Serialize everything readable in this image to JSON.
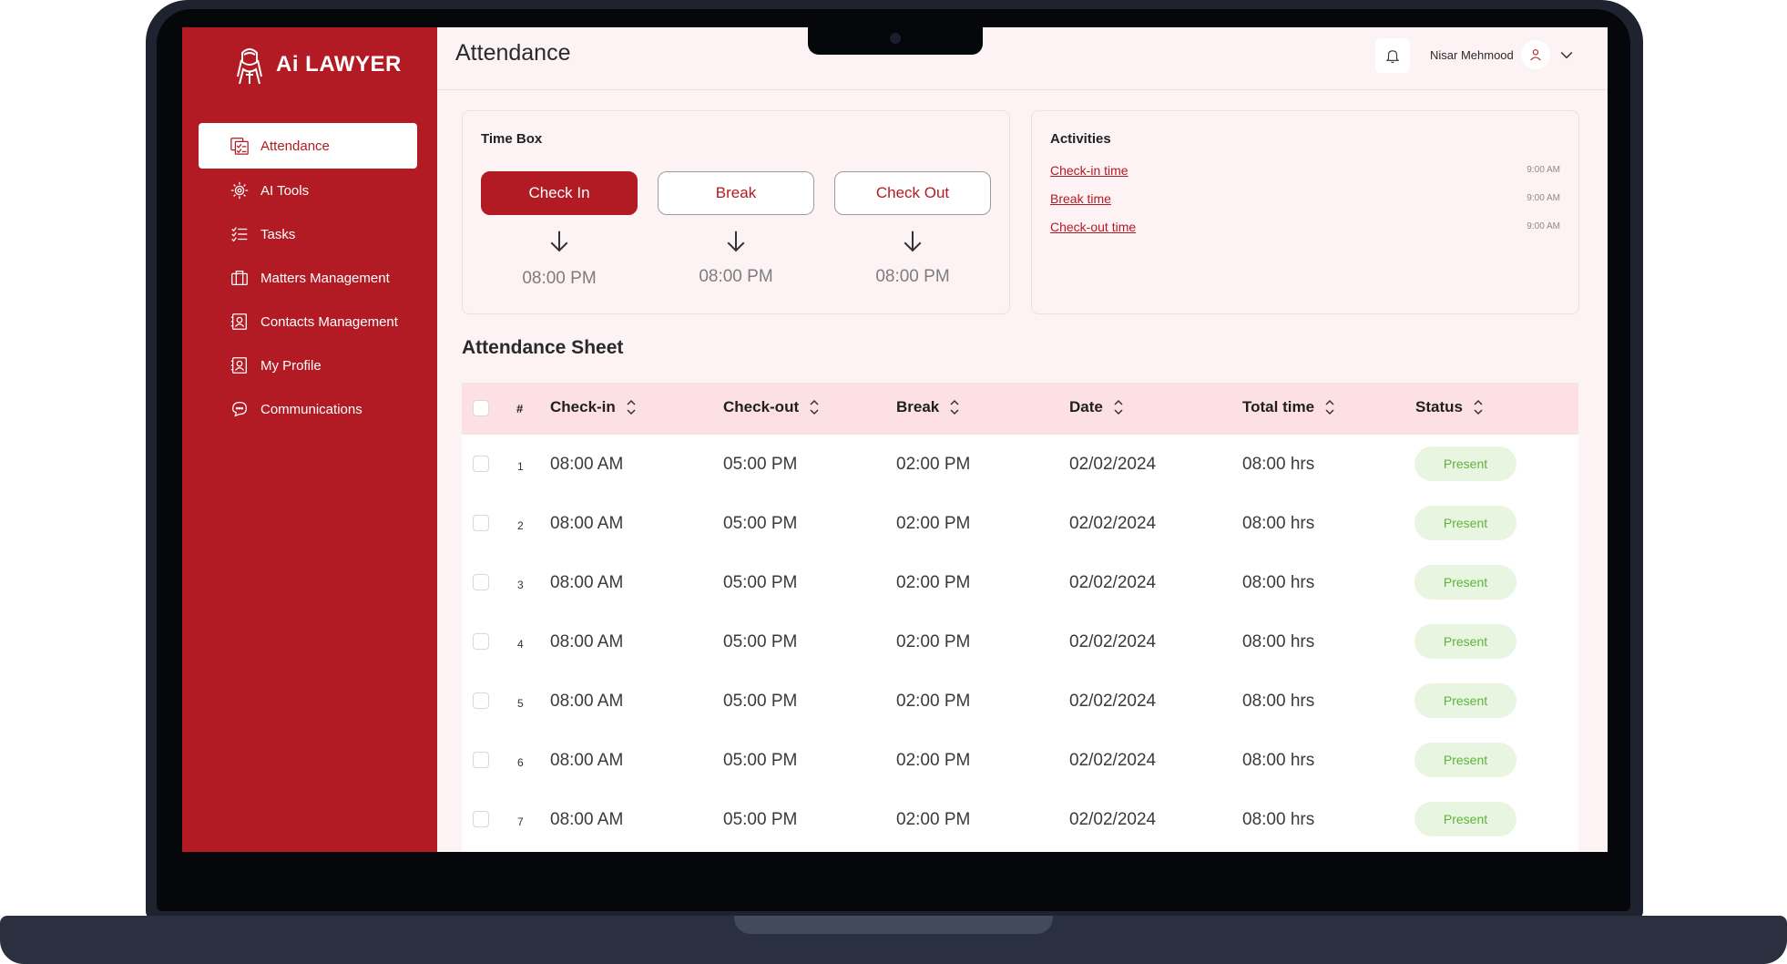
{
  "app": {
    "brand_prefix": "Ai",
    "brand_suffix": "LAWYER"
  },
  "sidebar": {
    "items": [
      {
        "label": "Attendance",
        "icon": "attendance-icon",
        "active": true
      },
      {
        "label": "AI Tools",
        "icon": "ai-tools-icon",
        "active": false
      },
      {
        "label": "Tasks",
        "icon": "tasks-icon",
        "active": false
      },
      {
        "label": "Matters Management",
        "icon": "briefcase-icon",
        "active": false
      },
      {
        "label": "Contacts Management",
        "icon": "contacts-icon",
        "active": false
      },
      {
        "label": "My Profile",
        "icon": "profile-icon",
        "active": false
      },
      {
        "label": "Communications",
        "icon": "chat-icon",
        "active": false
      }
    ]
  },
  "header": {
    "title": "Attendance",
    "user_name": "Nisar Mehmood"
  },
  "timebox": {
    "title": "Time Box",
    "buttons": [
      {
        "label": "Check In",
        "time": "08:00 PM"
      },
      {
        "label": "Break",
        "time": "08:00 PM"
      },
      {
        "label": "Check Out",
        "time": "08:00 PM"
      }
    ]
  },
  "activities": {
    "title": "Activities",
    "items": [
      {
        "label": "Check-in time",
        "time": "9:00 AM"
      },
      {
        "label": "Break time",
        "time": "9:00 AM"
      },
      {
        "label": "Check-out time",
        "time": "9:00 AM"
      }
    ]
  },
  "sheet": {
    "title": "Attendance Sheet",
    "columns": {
      "hash": "#",
      "checkin": "Check-in",
      "checkout": "Check-out",
      "break": "Break",
      "date": "Date",
      "total": "Total time",
      "status": "Status"
    },
    "rows": [
      {
        "num": "1",
        "checkin": "08:00 AM",
        "checkout": "05:00 PM",
        "break": "02:00 PM",
        "date": "02/02/2024",
        "total": "08:00 hrs",
        "status": "Present"
      },
      {
        "num": "2",
        "checkin": "08:00 AM",
        "checkout": "05:00 PM",
        "break": "02:00 PM",
        "date": "02/02/2024",
        "total": "08:00 hrs",
        "status": "Present"
      },
      {
        "num": "3",
        "checkin": "08:00 AM",
        "checkout": "05:00 PM",
        "break": "02:00 PM",
        "date": "02/02/2024",
        "total": "08:00 hrs",
        "status": "Present"
      },
      {
        "num": "4",
        "checkin": "08:00 AM",
        "checkout": "05:00 PM",
        "break": "02:00 PM",
        "date": "02/02/2024",
        "total": "08:00 hrs",
        "status": "Present"
      },
      {
        "num": "5",
        "checkin": "08:00 AM",
        "checkout": "05:00 PM",
        "break": "02:00 PM",
        "date": "02/02/2024",
        "total": "08:00 hrs",
        "status": "Present"
      },
      {
        "num": "6",
        "checkin": "08:00 AM",
        "checkout": "05:00 PM",
        "break": "02:00 PM",
        "date": "02/02/2024",
        "total": "08:00 hrs",
        "status": "Present"
      },
      {
        "num": "7",
        "checkin": "08:00 AM",
        "checkout": "05:00 PM",
        "break": "02:00 PM",
        "date": "02/02/2024",
        "total": "08:00 hrs",
        "status": "Present"
      }
    ]
  },
  "colors": {
    "brand": "#b31b24",
    "page_bg": "#fdf3f5",
    "table_header_bg": "#fde0e4",
    "status_present_bg": "#e8f5e1",
    "status_present_text": "#5fb33a"
  }
}
